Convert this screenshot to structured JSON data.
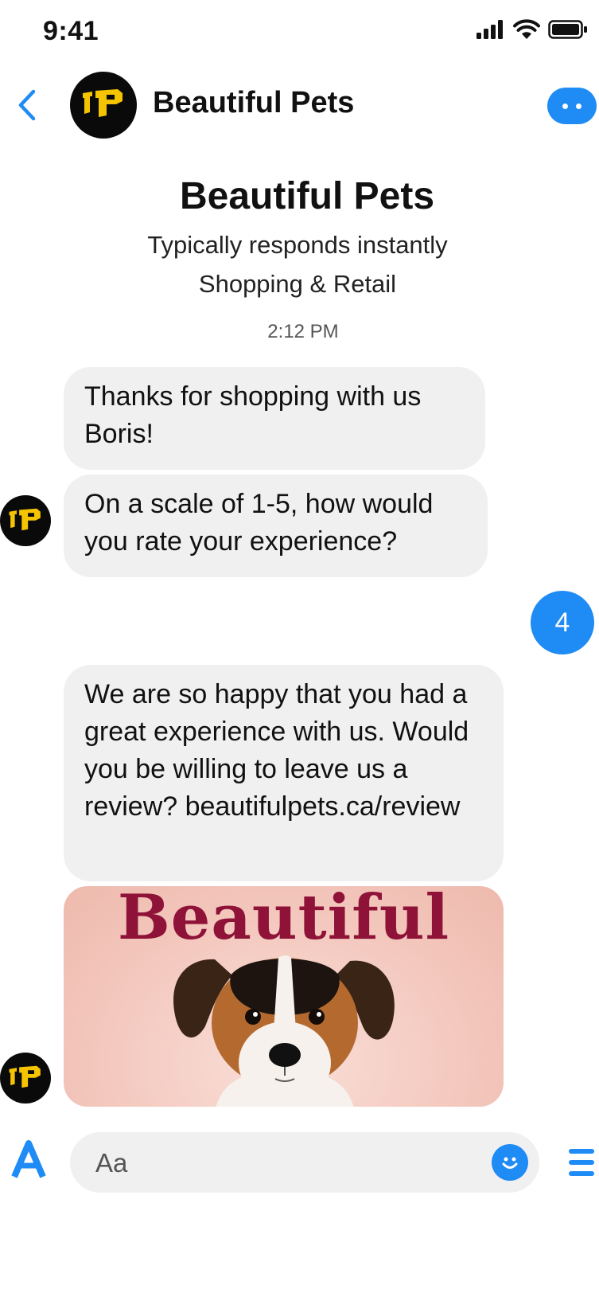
{
  "status_bar": {
    "time": "9:41"
  },
  "header": {
    "title": "Beautiful Pets"
  },
  "intro": {
    "name": "Beautiful Pets",
    "responsiveness": "Typically responds instantly",
    "category": "Shopping & Retail"
  },
  "timestamp": "2:12 PM",
  "messages": [
    {
      "from": "page",
      "text": "Thanks for shopping with us Boris!"
    },
    {
      "from": "page",
      "text": "On a scale of 1-5, how would you rate your experience?"
    },
    {
      "from": "user",
      "text": "4"
    },
    {
      "from": "page",
      "text": "We are so happy that you had a great experience with us. Would you be willing to leave us a review? beautifulpets.ca/review"
    }
  ],
  "image_card": {
    "word": "Beautiful"
  },
  "composer": {
    "placeholder": "Aa"
  },
  "colors": {
    "accent": "#1f8bf5",
    "bubble": "#f0f0f0",
    "brand_word": "#8f1338",
    "logo_yellow": "#f5c400"
  },
  "icons": [
    "back-chevron-icon",
    "more-icon",
    "text-format-icon",
    "emoji-icon",
    "menu-icon",
    "signal-icon",
    "wifi-icon",
    "battery-icon"
  ]
}
